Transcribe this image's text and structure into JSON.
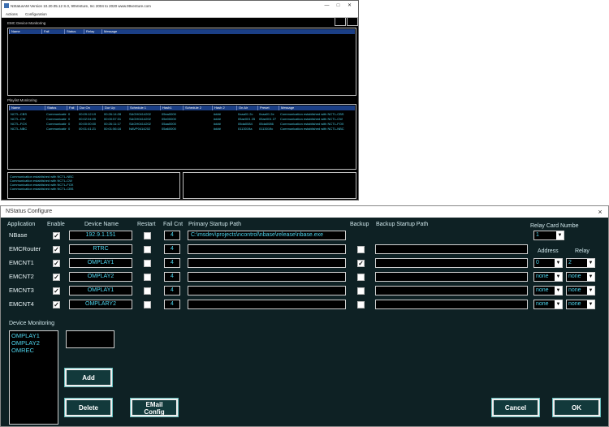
{
  "top_window": {
    "title": "NStatusAM Version 10.20.05.12 S.0, 99Venture, Inc 2004 to 2020 www.99venture.com",
    "menu": [
      "Actions",
      "Configuration"
    ],
    "emc_section_title": "EMC Device Monitoring",
    "emc_columns": [
      "Name",
      "Fail",
      "Status",
      "Relay",
      "Message"
    ],
    "playlist_section_title": "Playlist Monitoring",
    "playlist_columns": [
      "Name",
      "Status",
      "Fail",
      "Dur On",
      "Dur Up",
      "Schedule 1",
      "Hash1",
      "Schedule 2",
      "Hash 2",
      "On Air",
      "Preset",
      "Message"
    ],
    "playlist_rows": [
      [
        "NCTL-CBS",
        "Communicating",
        "0",
        "00:09:12:19",
        "00:26:14:28",
        "SAGH0414202",
        "05ea0000",
        "",
        "####",
        "0xaa01 2c",
        "0xaa01 2e",
        "Communication established with NCTL-CBS"
      ],
      [
        "NCTL-CW",
        "Communicating",
        "0",
        "00:02:04:05",
        "00:00:57:31",
        "SAGH0414202",
        "05e00000",
        "",
        "####",
        "05ae001 25",
        "05ae001 27",
        "Communication established with NCTL-CW"
      ],
      [
        "NCTL-FOX",
        "Communicating",
        "0",
        "00:00:00:00",
        "00:26:11:17",
        "SAGH0414202",
        "05aa0000",
        "",
        "####",
        "05da0084",
        "05da0086",
        "Communication established with NCTL-FOX"
      ],
      [
        "NCTL-NBC",
        "Communicating",
        "0",
        "00:01:41:21",
        "00:01:56:16",
        "NAVP0414202",
        "05a60000",
        "",
        "####",
        "0113019a",
        "0113019c",
        "Communication established with NCTL-NBC"
      ]
    ],
    "log_lines": [
      "Communication established with NCTL-NBC",
      "Communication established with NCTL-CW",
      "Communication established with NCTL-FOX",
      "Communication established with NCTL-CBS"
    ]
  },
  "dialog": {
    "title": "NStatus Configure",
    "close_glyph": "×",
    "headers": {
      "application": "Application",
      "enable": "Enable",
      "device_name": "Device Name",
      "restart": "Restart",
      "fail_cnt": "Fail Cnt",
      "primary_path": "Primary Startup Path",
      "backup": "Backup",
      "backup_path": "Backup Startup Path",
      "relay_card_number": "Relay Card Numbe",
      "address": "Address",
      "relay": "Relay"
    },
    "relay_card_value": "1",
    "rows": [
      {
        "app": "NBase",
        "enabled": true,
        "device": "192.9.1.151",
        "restart": false,
        "fail": "4",
        "primary": "C:\\msdev\\projects\\ncontrol\\nbase\\release\\nbase.exe",
        "has_backup": false,
        "backup": "",
        "address": null,
        "relay": null
      },
      {
        "app": "EMCRouter",
        "enabled": true,
        "device": "RTRC",
        "restart": false,
        "fail": "4",
        "primary": "",
        "has_backup": true,
        "backup_checked": false,
        "backup": "",
        "address": null,
        "relay": null
      },
      {
        "app": "EMCNT1",
        "enabled": true,
        "device": "OMPLAY1",
        "restart": false,
        "fail": "4",
        "primary": "",
        "has_backup": true,
        "backup_checked": true,
        "backup": "",
        "address": "0",
        "relay": "2"
      },
      {
        "app": "EMCNT2",
        "enabled": true,
        "device": "OMPLAY2",
        "restart": false,
        "fail": "4",
        "primary": "",
        "has_backup": true,
        "backup_checked": false,
        "backup": "",
        "address": "none",
        "relay": "none"
      },
      {
        "app": "EMCNT3",
        "enabled": true,
        "device": "OMPLAY1",
        "restart": false,
        "fail": "4",
        "primary": "",
        "has_backup": true,
        "backup_checked": false,
        "backup": "",
        "address": "none",
        "relay": "none"
      },
      {
        "app": "EMCNT4",
        "enabled": true,
        "device": "OMPLARY2",
        "restart": false,
        "fail": "4",
        "primary": "",
        "has_backup": true,
        "backup_checked": false,
        "backup": "",
        "address": "none",
        "relay": "none"
      }
    ],
    "device_monitoring_label": "Device Monitoring",
    "device_monitoring_items": [
      "OMPLAY1",
      "OMPLAY2",
      "OMREC"
    ],
    "device_entry_value": "",
    "buttons": {
      "add": "Add",
      "delete": "Delete",
      "email": "EMail Config",
      "cancel": "Cancel",
      "ok": "OK"
    },
    "check_glyph": "✓"
  }
}
